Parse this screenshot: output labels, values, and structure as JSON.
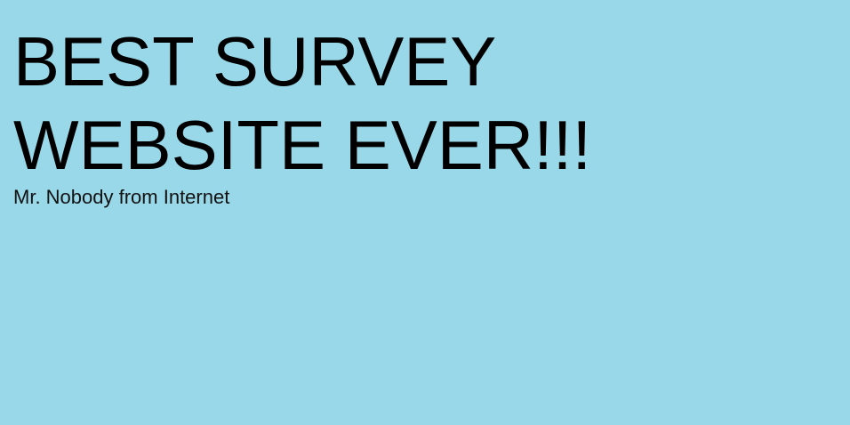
{
  "page": {
    "background_color": "#98d8e8",
    "text_color": "#000000"
  },
  "header": {
    "title": "BEST SURVEY WEBSITE EVER!!!",
    "subtitle": "Mr. Nobody from Internet"
  }
}
